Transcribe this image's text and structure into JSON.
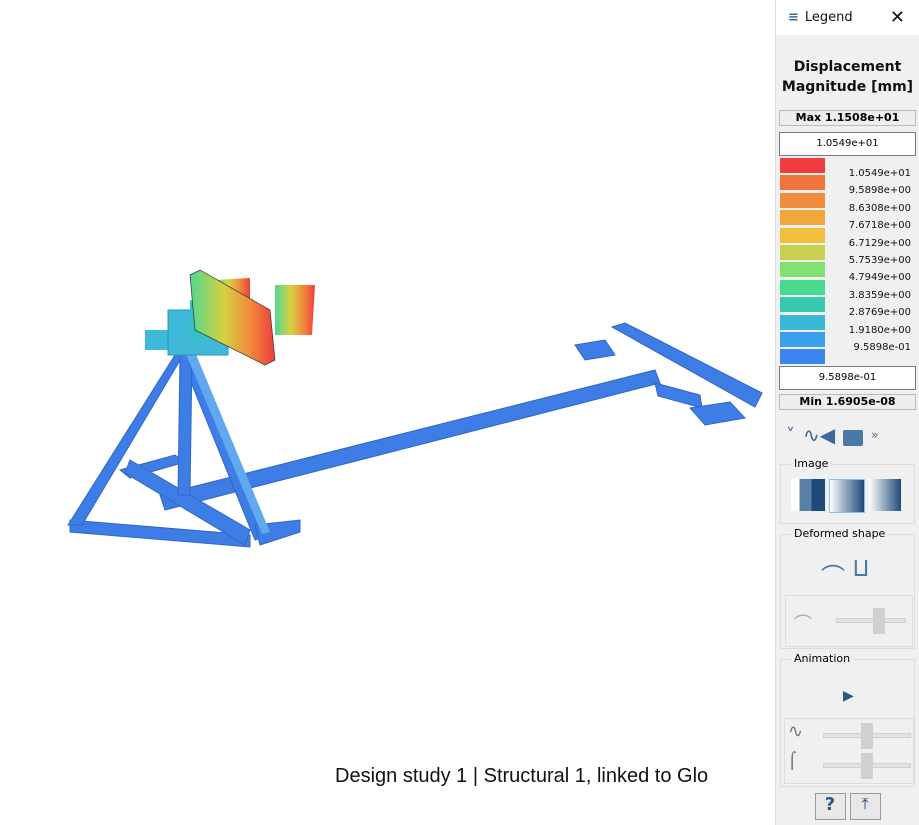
{
  "viewport": {
    "caption": "Design study 1 | Structural 1, linked to Glo"
  },
  "legend": {
    "title": "Legend",
    "heading_line1": "Displacement",
    "heading_line2": "Magnitude [mm]",
    "max_label": "Max  1.1508e+01",
    "upper_input": "1.0549e+01",
    "lower_input": "9.5898e-01",
    "min_label": "Min  1.6905e-08",
    "colors": [
      "#f03c3f",
      "#f1733c",
      "#f08d3c",
      "#f0a73c",
      "#f0c03c",
      "#c8d050",
      "#84e070",
      "#48da8c",
      "#38c8b0",
      "#3ab8d8",
      "#3aa0ee",
      "#3c84ee"
    ],
    "labels": [
      "1.0549e+01",
      "9.5898e+00",
      "8.6308e+00",
      "7.6718e+00",
      "6.7129e+00",
      "5.7539e+00",
      "4.7949e+00",
      "3.8359e+00",
      "2.8769e+00",
      "1.9180e+00",
      "9.5898e-01"
    ],
    "sections": {
      "image": "Image",
      "deformed": "Deformed shape",
      "animation": "Animation"
    },
    "help": "?"
  }
}
